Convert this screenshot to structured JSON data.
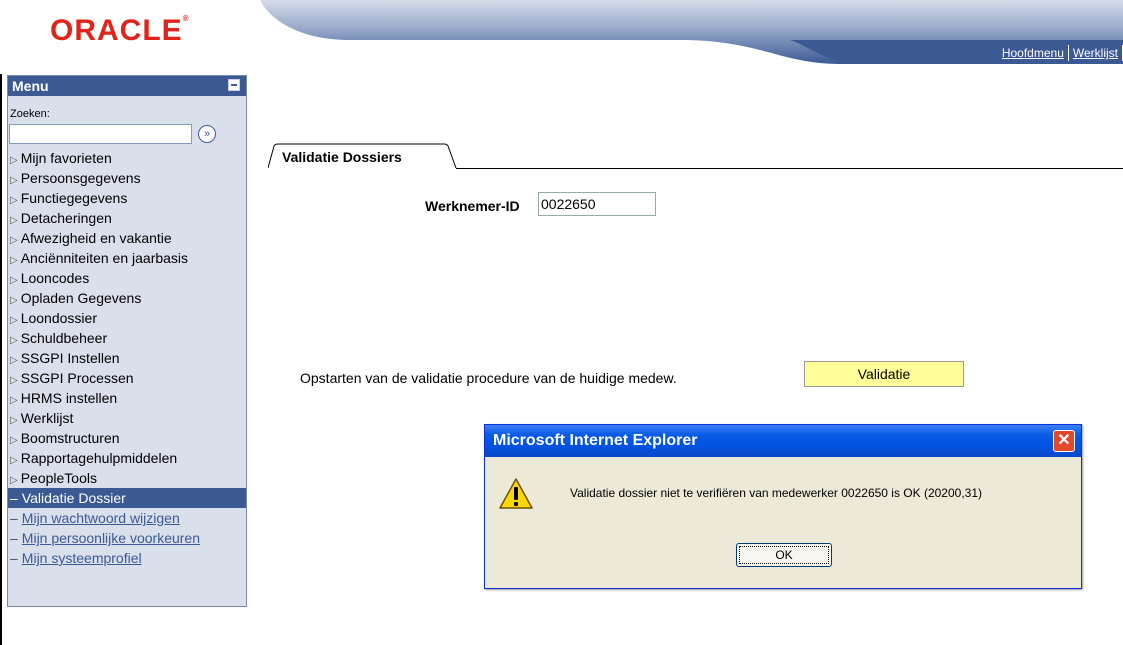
{
  "header": {
    "logo": "ORACLE",
    "links": [
      "Hoofdmenu",
      "Werklijst"
    ]
  },
  "menu": {
    "title": "Menu",
    "search_label": "Zoeken:",
    "search_value": "",
    "items": [
      "Mijn favorieten",
      "Persoonsgegevens",
      "Functiegegevens",
      "Detacheringen",
      "Afwezigheid en vakantie",
      "Anciënniteiten en jaarbasis",
      "Looncodes",
      "Opladen Gegevens",
      "Loondossier",
      "Schuldbeheer",
      "SSGPI Instellen",
      "SSGPI Processen",
      "HRMS instellen",
      "Werklijst",
      "Boomstructuren",
      "Rapportagehulpmiddelen",
      "PeopleTools"
    ],
    "selected": "Validatie Dossier",
    "links": [
      "Mijn wachtwoord wijzigen",
      "Mijn persoonlijke voorkeuren",
      "Mijn systeemprofiel"
    ]
  },
  "page": {
    "tab_label": "Validatie Dossiers",
    "employee_label": "Werknemer-ID",
    "employee_value": "0022650",
    "instruction": "Opstarten van de validatie procedure van de huidige medew.",
    "button_label": "Validatie"
  },
  "dialog": {
    "title": "Microsoft Internet Explorer",
    "message": "Validatie dossier niet te verifiëren van medewerker 0022650 is OK (20200,31)",
    "ok_label": "OK"
  },
  "colors": {
    "menu_header": "#3b5a93",
    "menu_bg": "#d9dfeb",
    "logo": "#e2231a",
    "button_bg": "#ffff99"
  }
}
